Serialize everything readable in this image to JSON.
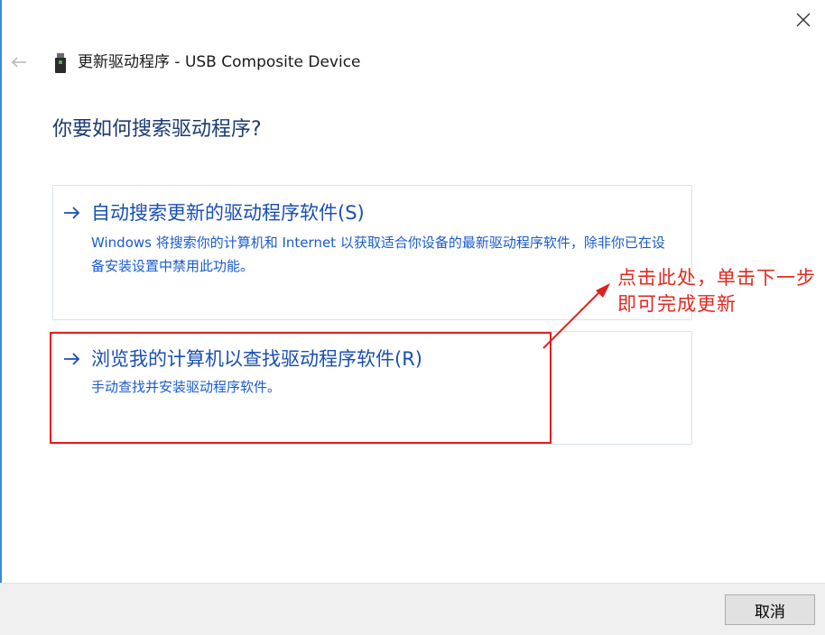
{
  "window": {
    "title": "更新驱动程序 - USB Composite Device",
    "device_icon": "usb-device-icon",
    "back_icon": "back-arrow-icon",
    "close_icon": "close-icon"
  },
  "main": {
    "question": "你要如何搜索驱动程序?",
    "options": [
      {
        "label": "自动搜索更新的驱动程序软件(S)",
        "description": "Windows 将搜索你的计算机和 Internet 以获取适合你设备的最新驱动程序软件，除非你已在设备安装设置中禁用此功能。",
        "icon": "arrow-right-icon"
      },
      {
        "label": "浏览我的计算机以查找驱动程序软件(R)",
        "description": "手动查找并安装驱动程序软件。",
        "icon": "arrow-right-icon"
      }
    ]
  },
  "annotation": {
    "text": "点击此处，单击下一步即可完成更新",
    "color": "#e02a1f"
  },
  "footer": {
    "cancel_label": "取消"
  },
  "colors": {
    "accent": "#1a4fb5",
    "title": "#1b3a72",
    "highlight_border": "#e02020"
  }
}
